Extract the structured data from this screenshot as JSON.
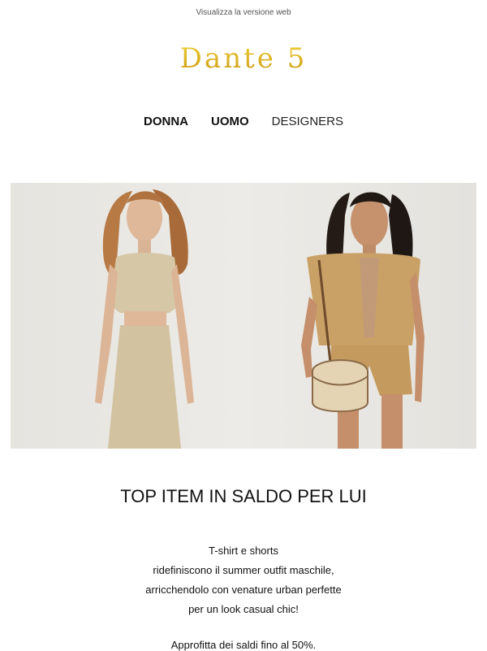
{
  "header": {
    "web_version_link": "Visualizza la versione web",
    "brand": "Dante 5"
  },
  "nav": {
    "items": [
      "DONNA",
      "UOMO",
      "DESIGNERS"
    ]
  },
  "hero": {
    "description_hidden": ""
  },
  "content": {
    "headline": "TOP ITEM IN SALDO PER LUI",
    "body_lines": [
      "T-shirt e shorts",
      "ridefiniscono il summer outfit maschile,",
      "arricchendolo con venature urban perfette",
      "per un look casual chic!"
    ],
    "promo": "Approfitta dei saldi fino al 50%."
  },
  "colors": {
    "brand_gold": "#d9b41f",
    "text": "#111111",
    "background": "#ffffff"
  }
}
